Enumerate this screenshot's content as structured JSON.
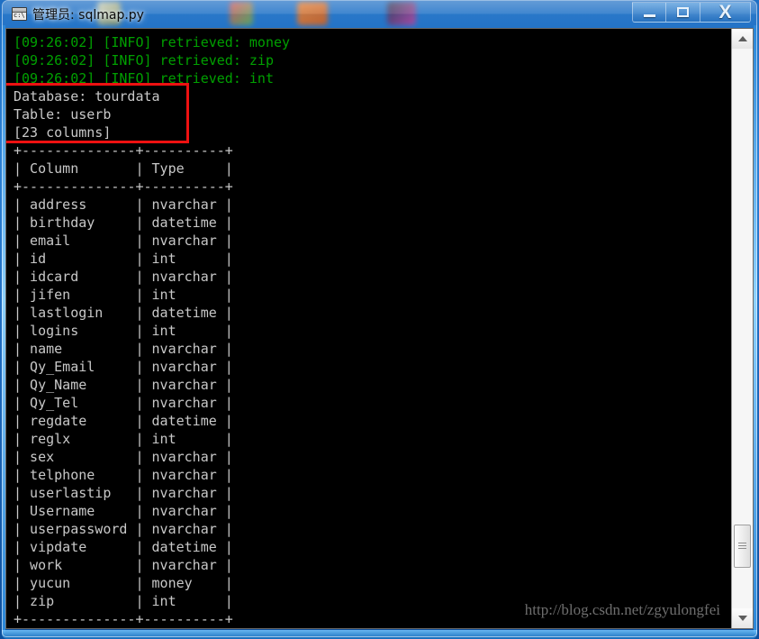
{
  "window": {
    "title": "管理员: sqlmap.py",
    "icon": "console-icon",
    "controls": {
      "minimize": "Minimize",
      "maximize": "Maximize",
      "close": "Close"
    }
  },
  "console": {
    "log_lines": [
      "[09:26:02] [INFO] retrieved: money",
      "[09:26:02] [INFO] retrieved: zip",
      "[09:26:02] [INFO] retrieved: int"
    ],
    "summary": {
      "database_label": "Database: tourdata",
      "table_label": "Table: userb",
      "column_count_label": "[23 columns]"
    },
    "table": {
      "separator": "+--------------+----------+",
      "headers": [
        "Column",
        "Type"
      ],
      "rows": [
        [
          "address",
          "nvarchar"
        ],
        [
          "birthday",
          "datetime"
        ],
        [
          "email",
          "nvarchar"
        ],
        [
          "id",
          "int"
        ],
        [
          "idcard",
          "nvarchar"
        ],
        [
          "jifen",
          "int"
        ],
        [
          "lastlogin",
          "datetime"
        ],
        [
          "logins",
          "int"
        ],
        [
          "name",
          "nvarchar"
        ],
        [
          "Qy_Email",
          "nvarchar"
        ],
        [
          "Qy_Name",
          "nvarchar"
        ],
        [
          "Qy_Tel",
          "nvarchar"
        ],
        [
          "regdate",
          "datetime"
        ],
        [
          "reglx",
          "int"
        ],
        [
          "sex",
          "nvarchar"
        ],
        [
          "telphone",
          "nvarchar"
        ],
        [
          "userlastip",
          "nvarchar"
        ],
        [
          "Username",
          "nvarchar"
        ],
        [
          "userpassword",
          "nvarchar"
        ],
        [
          "vipdate",
          "datetime"
        ],
        [
          "work",
          "nvarchar"
        ],
        [
          "yucun",
          "money"
        ],
        [
          "zip",
          "int"
        ]
      ]
    },
    "colors": {
      "log_green": "#00a000",
      "text_gray": "#c8c8c8",
      "background": "#000000",
      "annotation_red": "#ee1111"
    }
  },
  "annotation": {
    "name": "red-highlight-box"
  },
  "watermark": {
    "text": "http://blog.csdn.net/zgyulongfei"
  },
  "scrollbar": {
    "up_arrow": "▲",
    "down_arrow": "▼",
    "thumb_position_percent": 85
  }
}
